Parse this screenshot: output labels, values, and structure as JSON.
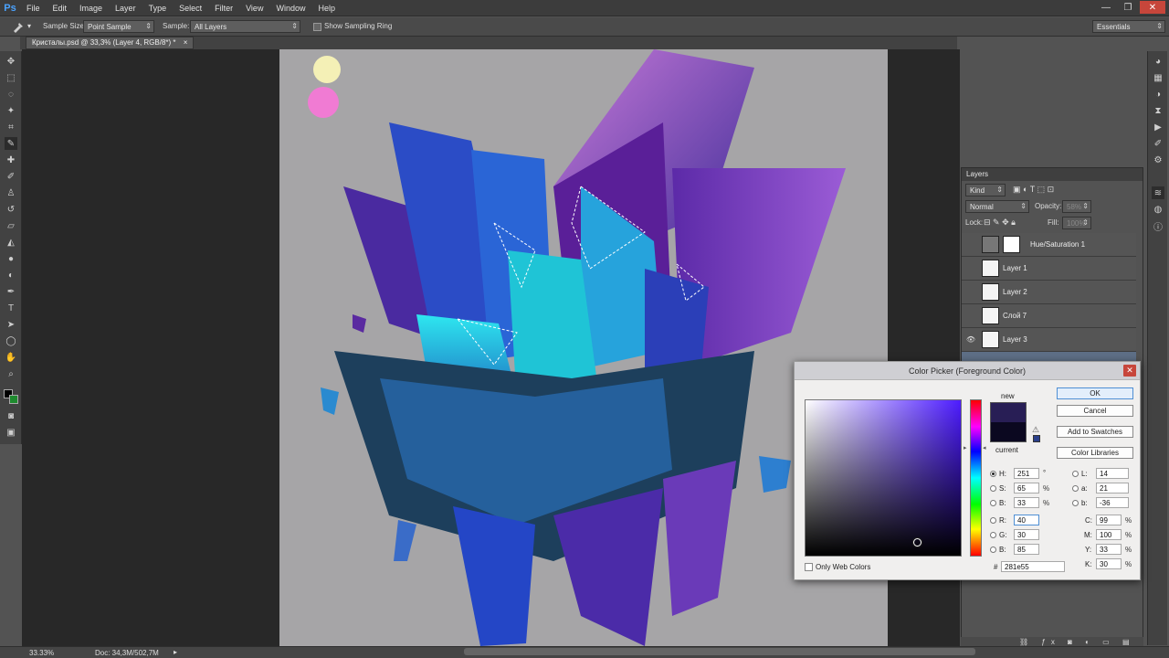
{
  "app": {
    "logo": "Ps"
  },
  "menu": [
    "File",
    "Edit",
    "Image",
    "Layer",
    "Type",
    "Select",
    "Filter",
    "View",
    "Window",
    "Help"
  ],
  "window_controls": {
    "minimize": "—",
    "restore": "❐",
    "close": "✕"
  },
  "options_bar": {
    "sample_size_label": "Sample Size:",
    "sample_size_value": "Point Sample",
    "sample_label": "Sample:",
    "sample_value": "All Layers",
    "show_ring_label": "Show Sampling Ring",
    "workspace": "Essentials"
  },
  "document_tab": {
    "title": "Кристалы.psd @ 33,3% (Layer 4, RGB/8*) *",
    "close": "×"
  },
  "status_bar": {
    "zoom": "33.33%",
    "doc": "Doc: 34,3M/502,7M"
  },
  "layers_panel": {
    "title": "Layers",
    "kind": "Kind",
    "blend_mode": "Normal",
    "opacity_label": "Opacity:",
    "opacity_value": "58%",
    "lock_label": "Lock:",
    "fill_label": "Fill:",
    "fill_value": "100%",
    "layers": [
      {
        "name": "Hue/Saturation 1",
        "visible": false
      },
      {
        "name": "Layer 1",
        "visible": false
      },
      {
        "name": "Layer 2",
        "visible": false
      },
      {
        "name": "Слой 7",
        "visible": false
      },
      {
        "name": "Layer 3",
        "visible": true
      }
    ]
  },
  "color_picker": {
    "title": "Color Picker (Foreground Color)",
    "close": "✕",
    "ok": "OK",
    "cancel": "Cancel",
    "add_to_swatches": "Add to Swatches",
    "color_libraries": "Color Libraries",
    "new_label": "new",
    "current_label": "current",
    "new_color": "#281e55",
    "current_color": "#0b0820",
    "only_web_colors": "Only Web Colors",
    "H": "251",
    "H_unit": "°",
    "S": "65",
    "S_unit": "%",
    "B": "33",
    "B_unit": "%",
    "R": "40",
    "G": "30",
    "B2": "85",
    "L": "14",
    "a": "21",
    "b": "-36",
    "C": "99",
    "M": "100",
    "Y": "33",
    "K": "30",
    "pct": "%",
    "hex_label": "#",
    "hex": "281e55"
  }
}
